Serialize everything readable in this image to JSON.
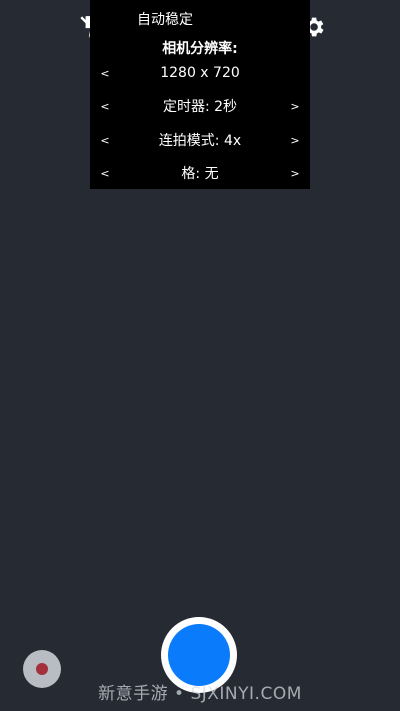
{
  "icons": {
    "flash": "flash-off-icon",
    "timer": "timer-ring-icon",
    "settings": "gear-icon"
  },
  "popup": {
    "header": "自动稳定",
    "title": "相机分辨率:",
    "resolution": {
      "prev": "<",
      "value": "1280 x 720"
    },
    "timer": {
      "prev": "<",
      "value": "定时器: 2秒",
      "next": ">"
    },
    "burst": {
      "prev": "<",
      "value": "连拍模式: 4x",
      "next": ">"
    },
    "grid": {
      "prev": "<",
      "value": "格: 无",
      "next": ">"
    }
  },
  "watermark": "新意手游 • SJXINYI.COM",
  "colors": {
    "background": "#262b33",
    "shutter": "#0a7cfb",
    "record_dot": "#a3303b"
  }
}
